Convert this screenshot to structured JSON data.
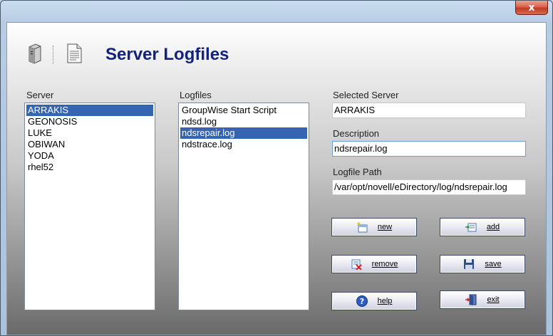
{
  "window": {
    "close_glyph": "x"
  },
  "header": {
    "title": "Server Logfiles",
    "icons": [
      "server-icon",
      "document-icon"
    ]
  },
  "server_list": {
    "label": "Server",
    "items": [
      "ARRAKIS",
      "GEONOSIS",
      "LUKE",
      "OBIWAN",
      "YODA",
      "rhel52"
    ],
    "selected": "ARRAKIS"
  },
  "logfile_list": {
    "label": "Logfiles",
    "items": [
      "GroupWise Start Script",
      "ndsd.log",
      "ndsrepair.log",
      "ndstrace.log"
    ],
    "selected": "ndsrepair.log"
  },
  "fields": {
    "selected_server": {
      "label": "Selected Server",
      "value": "ARRAKIS"
    },
    "description": {
      "label": "Description",
      "value": "ndsrepair.log"
    },
    "logfile_path": {
      "label": "Logfile Path",
      "value": "/var/opt/novell/eDirectory/log/ndsrepair.log"
    }
  },
  "buttons": {
    "new": "new",
    "add": "add",
    "remove": "remove",
    "save": "save",
    "help": "help",
    "exit": "exit"
  },
  "colors": {
    "title": "#13237b",
    "selection": "#3365b0",
    "close": "#c23a22"
  }
}
